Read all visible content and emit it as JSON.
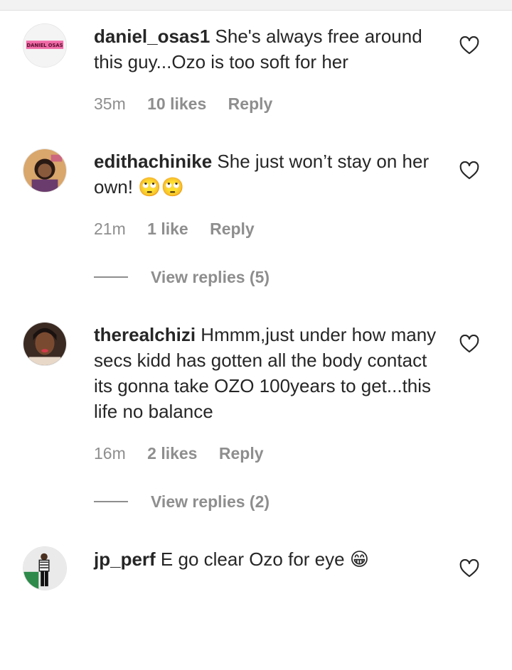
{
  "comments": [
    {
      "username": "daniel_osas1",
      "text": "She's always free around this guy...Ozo is too soft for her",
      "time": "35m",
      "likes": "10 likes",
      "reply_label": "Reply",
      "avatar_text": "DANIEL OSAS"
    },
    {
      "username": "edithachinike",
      "text": "She just won’t stay on her own! 🙄🙄",
      "time": "21m",
      "likes": "1 like",
      "reply_label": "Reply",
      "view_replies": "View replies (5)"
    },
    {
      "username": "therealchizi",
      "text": "Hmmm,just under how many secs kidd has gotten all the body contact its gonna take OZO 100years to get...this life no balance",
      "time": "16m",
      "likes": "2 likes",
      "reply_label": "Reply",
      "view_replies": "View replies (2)"
    },
    {
      "username": "jp_perf",
      "text": "E go clear Ozo for eye 😁"
    }
  ],
  "colors": {
    "text": "#262626",
    "secondary": "#8e8e8e",
    "divider": "#e0e0e0"
  },
  "icons": {
    "like": "heart-outline-icon"
  }
}
